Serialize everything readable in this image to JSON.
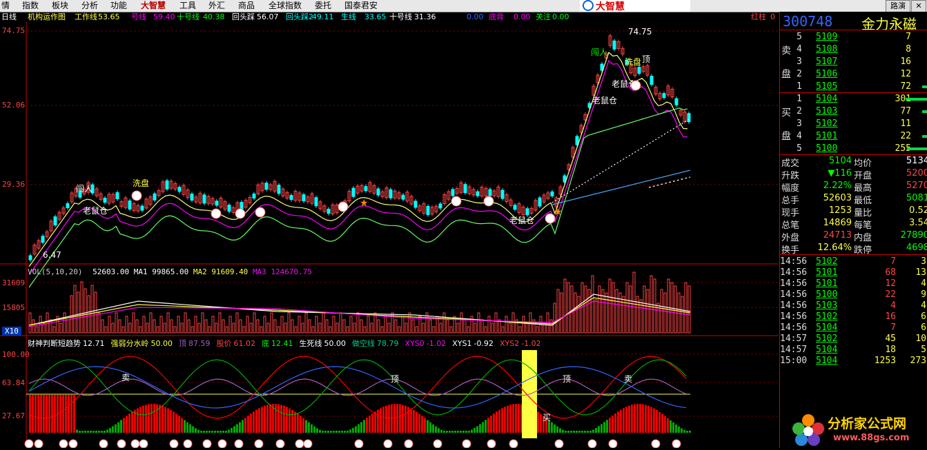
{
  "menu": [
    "情",
    "指数",
    "板块",
    "分析",
    "功能",
    "大智慧",
    "工具",
    "外汇",
    "商品",
    "全球指数",
    "委托",
    "国泰君安"
  ],
  "window_button": "路演",
  "logo_text": "大智慧",
  "indicator_row": [
    {
      "text": "日线",
      "color": "#fff"
    },
    {
      "text": "机构运作图",
      "color": "#ff4"
    },
    {
      "text": "工作线",
      "color": "#ff4"
    },
    {
      "text": "53.65",
      "color": "#ff4"
    },
    {
      "text": "号线",
      "color": "#f0f"
    },
    {
      "text": "59.40",
      "color": "#f0f"
    },
    {
      "text": "十号线",
      "color": "#0f0"
    },
    {
      "text": "40.38",
      "color": "#0f0"
    },
    {
      "text": "回头踩",
      "color": "#fff"
    },
    {
      "text": "56.07",
      "color": "#fff"
    },
    {
      "text": "回头踩2",
      "color": "#0ff"
    },
    {
      "text": "49.11",
      "color": "#0ff"
    },
    {
      "text": "生线",
      "color": "#0ff"
    },
    {
      "text": "33.65",
      "color": "#0ff"
    },
    {
      "text": "十号线",
      "color": "#fff"
    },
    {
      "text": "31.36",
      "color": "#fff"
    },
    {
      "text": "0.00",
      "color": "#36f"
    },
    {
      "text": "底背",
      "color": "#f0f"
    },
    {
      "text": "0.00",
      "color": "#f0f"
    },
    {
      "text": "关注",
      "color": "#0f0"
    },
    {
      "text": "0.00",
      "color": "#0f0"
    },
    {
      "text": "红柱",
      "color": "#f44"
    },
    {
      "text": "0",
      "color": "#f44"
    }
  ],
  "price_axis": {
    "top": "74.75",
    "mid1": "52.06",
    "mid2": "29.36"
  },
  "annotations": {
    "high": "74.75",
    "low": "6.47",
    "chuang_ren": "闯人",
    "xi_pan": "洗盘",
    "lao_shu_cang": "老鼠仓",
    "ding": "顶",
    "mai": "卖",
    "mai_buy": "买"
  },
  "vol_header": {
    "name": "VOL(5,10,20)",
    "vol": "52603.00",
    "ma1_label": "MA1",
    "ma1": "99865.00",
    "ma2_label": "MA2",
    "ma2": "91609.40",
    "ma3_label": "MA3",
    "ma3": "124670.75"
  },
  "vol_axis": {
    "top": "31609",
    "mid": "15805",
    "scale": "X10"
  },
  "osc_header": [
    {
      "text": "财神判断短趋势",
      "color": "#fff"
    },
    {
      "text": "12.71",
      "color": "#fff"
    },
    {
      "text": "强弱分水岭",
      "color": "#ff4"
    },
    {
      "text": "50.00",
      "color": "#ff4"
    },
    {
      "text": "顶",
      "color": "#a060c0"
    },
    {
      "text": "87.59",
      "color": "#a060c0"
    },
    {
      "text": "股价",
      "color": "#f44"
    },
    {
      "text": "61.02",
      "color": "#f44"
    },
    {
      "text": "底",
      "color": "#0f0"
    },
    {
      "text": "12.41",
      "color": "#0f0"
    },
    {
      "text": "生死线",
      "color": "#fff"
    },
    {
      "text": "50.00",
      "color": "#fff"
    },
    {
      "text": "做空线",
      "color": "#0c8"
    },
    {
      "text": "78.79",
      "color": "#0c8"
    },
    {
      "text": "XYS0",
      "color": "#f0f"
    },
    {
      "text": "-1.02",
      "color": "#f0f"
    },
    {
      "text": "XYS1",
      "color": "#fff"
    },
    {
      "text": "-0.92",
      "color": "#fff"
    },
    {
      "text": "XYS2",
      "color": "#f44"
    },
    {
      "text": "-1.02",
      "color": "#f44"
    }
  ],
  "osc_axis": {
    "top": "100.00",
    "mid": "63.84",
    "low": "27.67"
  },
  "quote": {
    "code": "300748",
    "name": "金力永磁",
    "sell_label_1": "卖",
    "sell_label_2": "盘",
    "buy_label_1": "买",
    "buy_label_2": "盘",
    "asks": [
      {
        "lvl": "5",
        "price": "5109",
        "vol": "7"
      },
      {
        "lvl": "4",
        "price": "5108",
        "vol": "8"
      },
      {
        "lvl": "3",
        "price": "5107",
        "vol": "16"
      },
      {
        "lvl": "2",
        "price": "5106",
        "vol": "12"
      },
      {
        "lvl": "1",
        "price": "5105",
        "vol": "72"
      }
    ],
    "bids": [
      {
        "lvl": "1",
        "price": "5104",
        "vol": "301"
      },
      {
        "lvl": "2",
        "price": "5103",
        "vol": "77"
      },
      {
        "lvl": "3",
        "price": "5102",
        "vol": "11"
      },
      {
        "lvl": "4",
        "price": "5101",
        "vol": "22"
      },
      {
        "lvl": "5",
        "price": "5100",
        "vol": "255"
      }
    ],
    "stats": [
      {
        "l1": "成交",
        "v1": "5104",
        "l2": "均价",
        "v2": "5134",
        "c1": "#0f0",
        "c2": "#fff"
      },
      {
        "l1": "升跌",
        "v1": "▼116",
        "l2": "开盘",
        "v2": "5200",
        "c1": "#0f0",
        "c2": "#f44"
      },
      {
        "l1": "幅度",
        "v1": "2.22%",
        "l2": "最高",
        "v2": "5270",
        "c1": "#0f0",
        "c2": "#f44"
      },
      {
        "l1": "总手",
        "v1": "52603",
        "l2": "最低",
        "v2": "5081",
        "c1": "#ff4",
        "c2": "#0f0"
      },
      {
        "l1": "现手",
        "v1": "1253",
        "l2": "量比",
        "v2": "0.52",
        "c1": "#ff4",
        "c2": "#ff4"
      },
      {
        "l1": "总笔",
        "v1": "14869",
        "l2": "每笔",
        "v2": "3.54",
        "c1": "#ff4",
        "c2": "#ff4"
      },
      {
        "l1": "外盘",
        "v1": "24713",
        "l2": "内盘",
        "v2": "27890",
        "c1": "#f44",
        "c2": "#0f0"
      },
      {
        "l1": "换手",
        "v1": "12.64%",
        "l2": "跌停",
        "v2": "4698",
        "c1": "#ff4",
        "c2": "#0f0"
      }
    ],
    "ticks": [
      {
        "t": "14:56",
        "p": "5102",
        "v": "7",
        "n": "3"
      },
      {
        "t": "14:56",
        "p": "5101",
        "v": "68",
        "n": "13"
      },
      {
        "t": "14:56",
        "p": "5101",
        "v": "12",
        "n": "4"
      },
      {
        "t": "14:56",
        "p": "5100",
        "v": "22",
        "n": "9"
      },
      {
        "t": "14:56",
        "p": "5103",
        "v": "4",
        "n": "4"
      },
      {
        "t": "14:56",
        "p": "5102",
        "v": "16",
        "n": "6"
      },
      {
        "t": "14:56",
        "p": "5104",
        "v": "7",
        "n": "6"
      },
      {
        "t": "14:57",
        "p": "5102",
        "v": "45",
        "n": "10"
      },
      {
        "t": "14:57",
        "p": "5104",
        "v": "18",
        "n": "5"
      },
      {
        "t": "15:00",
        "p": "5104",
        "v": "1253",
        "n": "273"
      }
    ]
  },
  "watermark": {
    "title": "分析家公式网",
    "url": "www.88gs.com"
  }
}
